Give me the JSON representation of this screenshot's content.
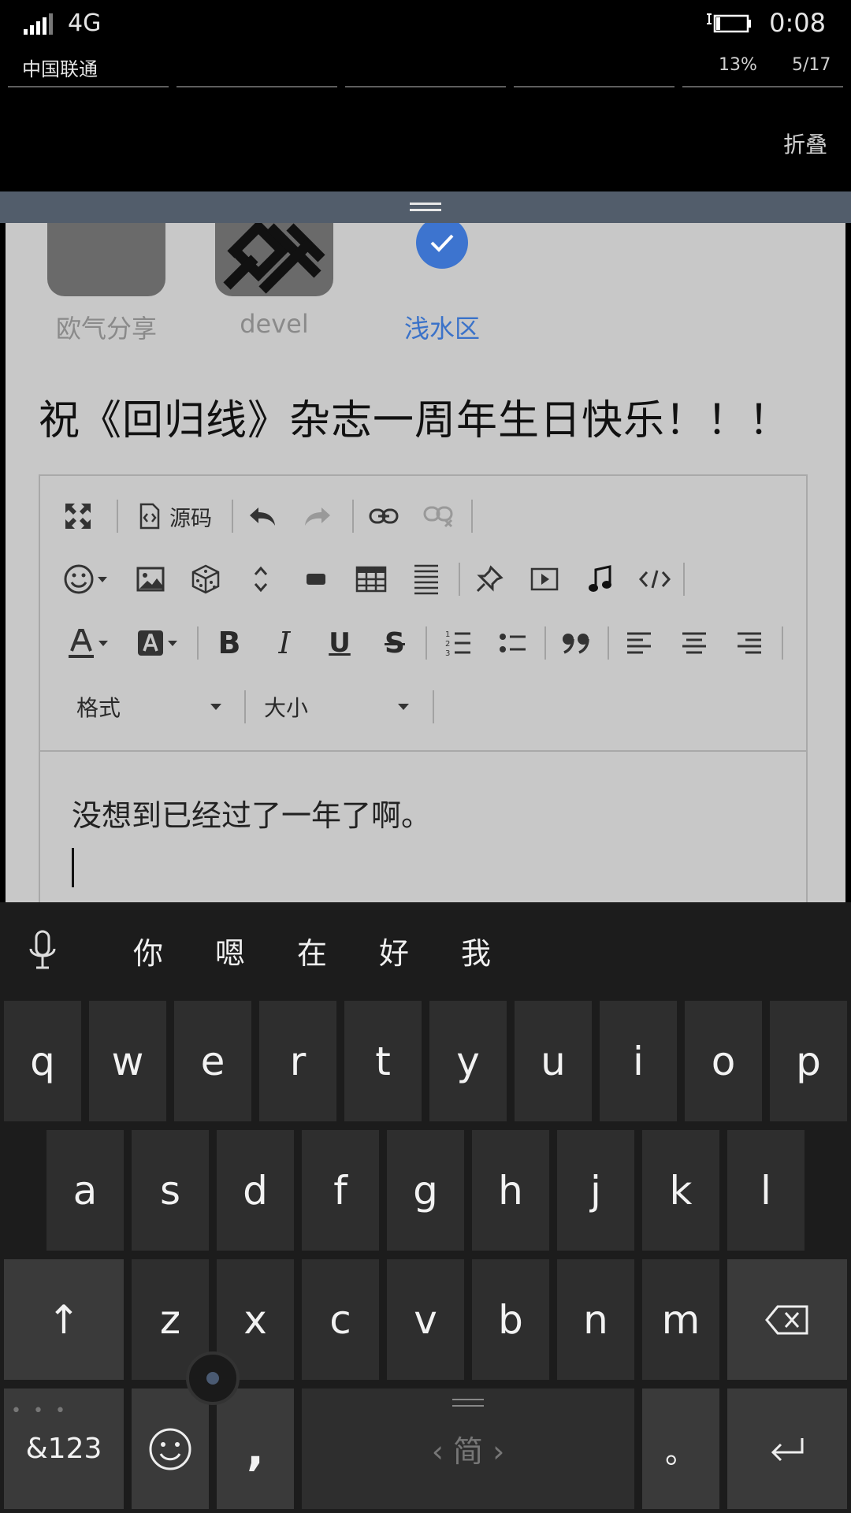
{
  "status": {
    "network": "4G",
    "time": "0:08",
    "carrier": "中国联通",
    "battery_percent": "13%",
    "page_indicator": "5/17",
    "collapse_label": "折叠"
  },
  "boards": [
    {
      "label": "欧气分享"
    },
    {
      "label": "devel"
    },
    {
      "label": "浅水区",
      "selected": true
    }
  ],
  "post": {
    "title": "祝《回归线》杂志一周年生日快乐！！！",
    "body": "没想到已经过了一年了啊。"
  },
  "editor": {
    "source_label": "源码",
    "format_label": "格式",
    "size_label": "大小",
    "icons": [
      "maximize-icon",
      "source-icon",
      "undo-icon",
      "redo-icon",
      "link-icon",
      "unlink-icon",
      "emoji-icon",
      "image-icon",
      "dice-icon",
      "expand-icon",
      "hr-icon",
      "table-icon",
      "align-lines-icon",
      "pin-icon",
      "video-icon",
      "music-icon",
      "code-icon",
      "font-color-icon",
      "bg-color-icon",
      "bold-icon",
      "italic-icon",
      "underline-icon",
      "strike-icon",
      "ordered-list-icon",
      "bullet-list-icon",
      "quote-icon",
      "align-left-icon",
      "align-center-icon",
      "align-right-icon"
    ]
  },
  "keyboard": {
    "candidates": [
      "你",
      "嗯",
      "在",
      "好",
      "我"
    ],
    "row1": [
      "q",
      "w",
      "e",
      "r",
      "t",
      "y",
      "u",
      "i",
      "o",
      "p"
    ],
    "row2": [
      "a",
      "s",
      "d",
      "f",
      "g",
      "h",
      "j",
      "k",
      "l"
    ],
    "row3": [
      "z",
      "x",
      "c",
      "v",
      "b",
      "n",
      "m"
    ],
    "symbols_label": "&123",
    "comma": ",",
    "space_label": "‹ 简 ›",
    "period": "。",
    "shift": "↑",
    "enter": "↵"
  }
}
